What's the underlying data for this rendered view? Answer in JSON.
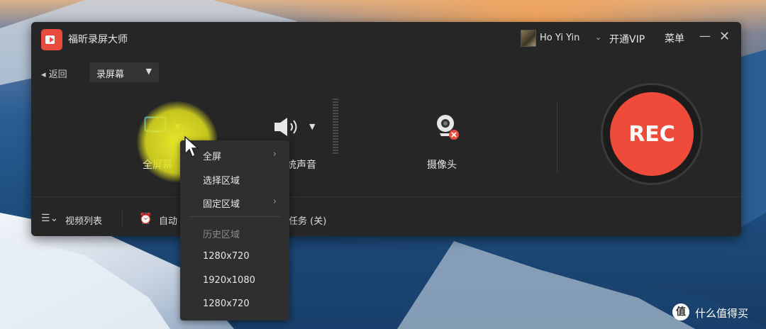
{
  "app": {
    "title": "福昕录屏大师",
    "username": "Ho Yi Yin",
    "vip_label": "开通VIP",
    "menu_label": "菜单",
    "minimize": "—",
    "close": "✕"
  },
  "nav": {
    "back_label": "返回",
    "mode_select": "录屏幕"
  },
  "sources": {
    "screen_label": "全屏幕",
    "system_sound_label": "统声音",
    "camera_label": "摄像头"
  },
  "record_button": "REC",
  "bottom_bar": {
    "video_list_label": "视频列表",
    "auto_label": "自动",
    "task_label": "任务 (关)"
  },
  "dropdown": {
    "items": [
      {
        "label": "全屏",
        "has_submenu": true
      },
      {
        "label": "选择区域",
        "has_submenu": false
      },
      {
        "label": "固定区域",
        "has_submenu": true
      }
    ],
    "history_header": "历史区域",
    "history": [
      "1280x720",
      "1920x1080",
      "1280x720"
    ]
  },
  "watermark": "什么值得买",
  "colors": {
    "window_bg": "#262626",
    "rec_red": "#ef4b3b",
    "accent_blue": "#3fa4d8",
    "highlight_yellow": "#e6e62a"
  }
}
